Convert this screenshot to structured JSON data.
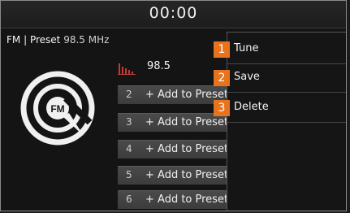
{
  "header": {
    "clock": "00:00"
  },
  "status": {
    "band": "FM",
    "separator": "|",
    "mode": "Preset",
    "frequency": "98.5 MHz"
  },
  "logo": {
    "text": "FM"
  },
  "now_playing": {
    "frequency": "98.5",
    "icon": "signal-bars-icon"
  },
  "presets": [
    {
      "number": "2",
      "label": "+ Add to Presets"
    },
    {
      "number": "3",
      "label": "+ Add to Presets"
    },
    {
      "number": "4",
      "label": "+ Add to Presets"
    },
    {
      "number": "5",
      "label": "+ Add to Presets"
    },
    {
      "number": "6",
      "label": "+ Add to Presets"
    }
  ],
  "menu": {
    "items": [
      {
        "number": "1",
        "label": "Tune"
      },
      {
        "number": "2",
        "label": "Save"
      },
      {
        "number": "3",
        "label": "Delete"
      }
    ]
  },
  "colors": {
    "badge": "#e8731f",
    "accent_bars": "#c43a3a",
    "preset_bg": "#454545"
  }
}
